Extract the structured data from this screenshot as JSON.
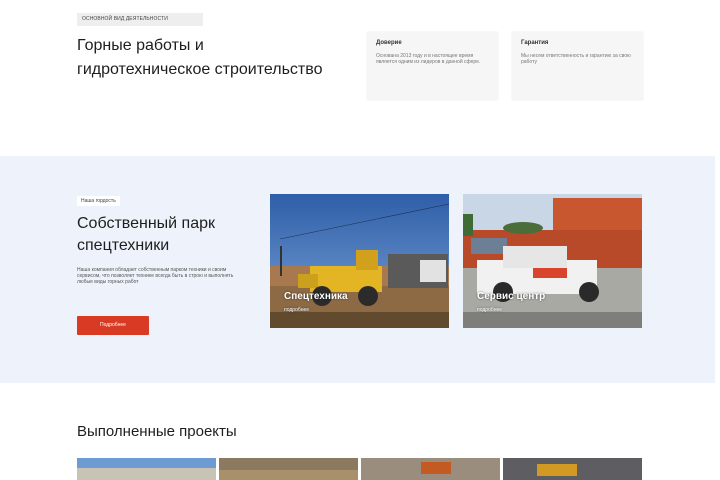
{
  "activity": {
    "tag": "основной вид деятельности",
    "heading": "Горные работы и гидротехническое строительство",
    "cards": [
      {
        "title": "Доверие",
        "text": "Основана 2013 году и в настоящее время является одним из лидеров в данной сфере."
      },
      {
        "title": "Гарантия",
        "text": "Мы несем ответственность и гарантию за свою работу"
      }
    ]
  },
  "fleet": {
    "tag": "Наша гордость",
    "heading": "Собственный парк спецтехники",
    "description": "Наша компания обладает собственным парком техники и своим сервисом, что позволяет технике всегда быть в строю и выполнять любые виды горных работ",
    "button": "Подробнее",
    "cards": [
      {
        "label": "Спецтехника",
        "sub": "подробнее"
      },
      {
        "label": "Сервис центр",
        "sub": "подробнее"
      }
    ]
  },
  "projects": {
    "heading": "Выполненные проекты"
  },
  "colors": {
    "accent": "#d93a23",
    "section_bg": "#eef3fb"
  }
}
